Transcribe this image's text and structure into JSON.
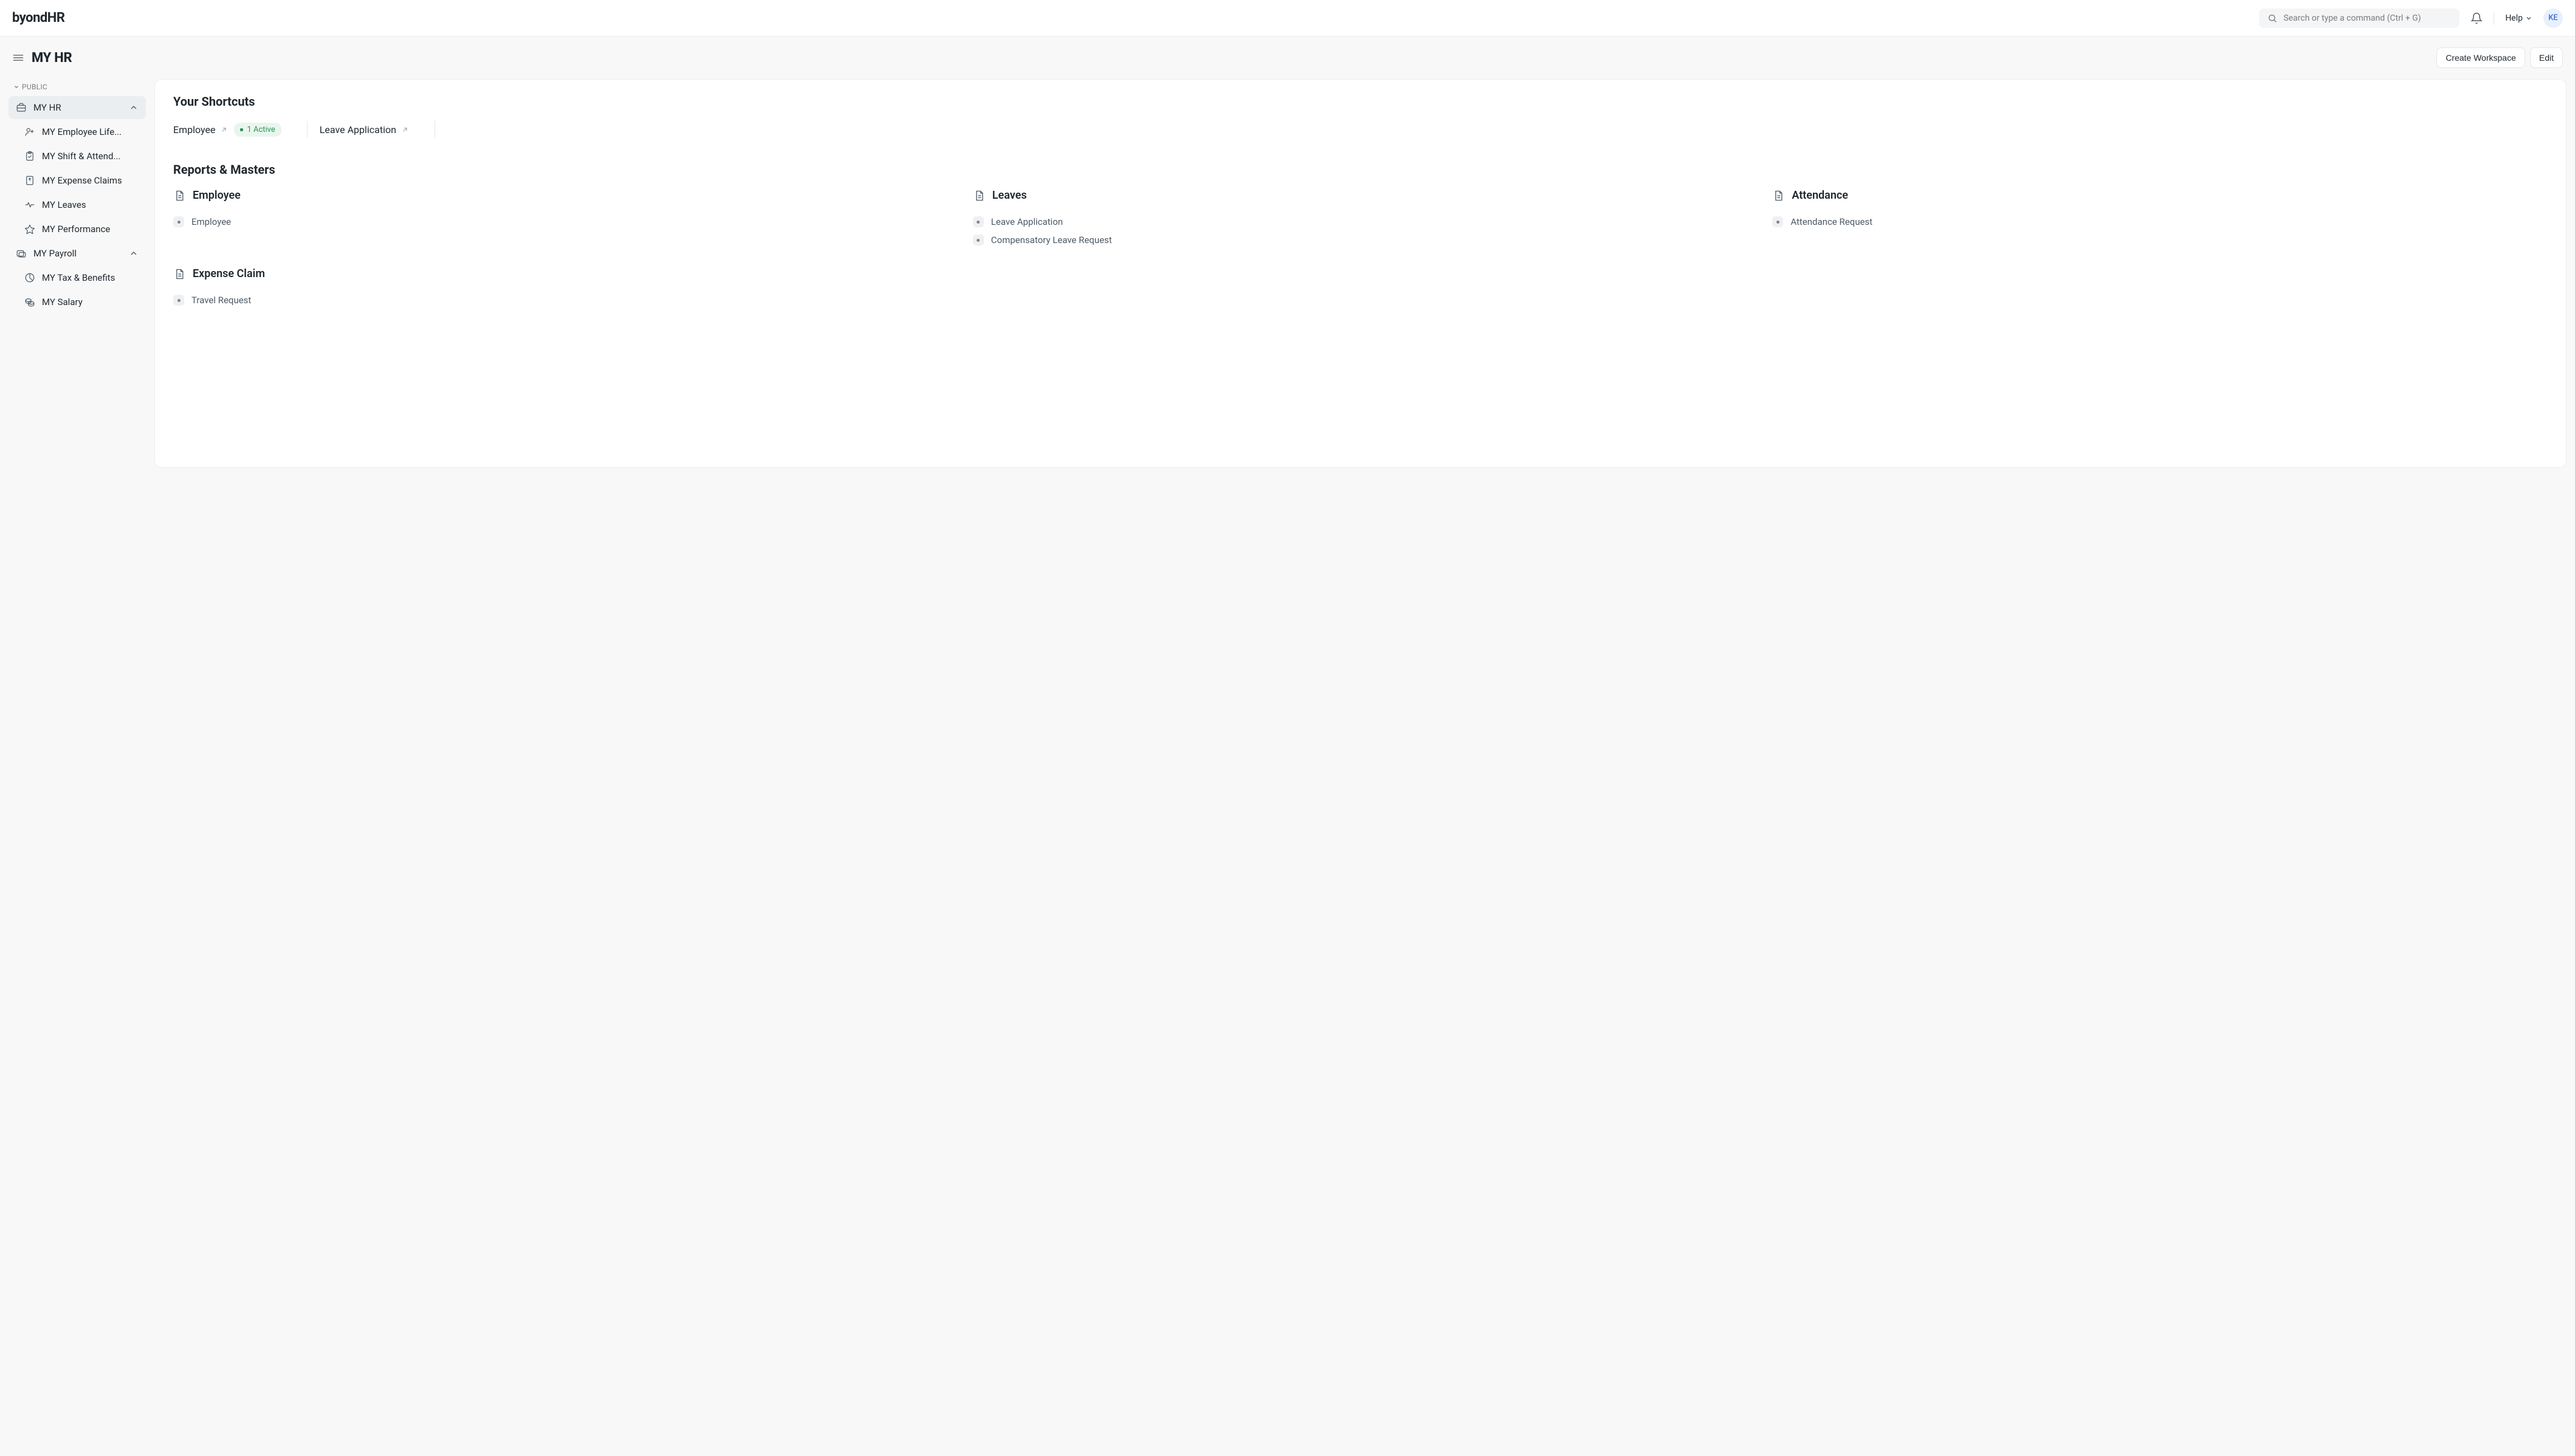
{
  "brand": "byondHR",
  "navbar": {
    "search_placeholder": "Search or type a command (Ctrl + G)",
    "help_label": "Help",
    "avatar_initials": "KE"
  },
  "header": {
    "title": "MY HR",
    "create_workspace_label": "Create Workspace",
    "edit_label": "Edit"
  },
  "sidebar": {
    "section_label": "PUBLIC",
    "items": [
      {
        "label": "MY HR",
        "icon": "briefcase",
        "active": true,
        "expandable": true
      },
      {
        "label": "MY Employee Life...",
        "icon": "user-plus",
        "child": true
      },
      {
        "label": "MY Shift & Attend...",
        "icon": "clipboard-check",
        "child": true
      },
      {
        "label": "MY Expense Claims",
        "icon": "receipt",
        "child": true
      },
      {
        "label": "MY Leaves",
        "icon": "heartbeat",
        "child": true
      },
      {
        "label": "MY Performance",
        "icon": "star",
        "child": true
      },
      {
        "label": "MY Payroll",
        "icon": "payroll",
        "expandable": true
      },
      {
        "label": "MY Tax & Benefits",
        "icon": "chart",
        "child": true
      },
      {
        "label": "MY Salary",
        "icon": "coins",
        "child": true
      }
    ]
  },
  "main": {
    "shortcuts_title": "Your Shortcuts",
    "shortcuts": [
      {
        "label": "Employee",
        "badge": "1 Active"
      },
      {
        "label": "Leave Application"
      }
    ],
    "reports_title": "Reports & Masters",
    "cards": [
      {
        "title": "Employee",
        "items": [
          "Employee"
        ]
      },
      {
        "title": "Leaves",
        "items": [
          "Leave Application",
          "Compensatory Leave Request"
        ]
      },
      {
        "title": "Attendance",
        "items": [
          "Attendance Request"
        ]
      },
      {
        "title": "Expense Claim",
        "items": [
          "Travel Request"
        ]
      }
    ]
  }
}
